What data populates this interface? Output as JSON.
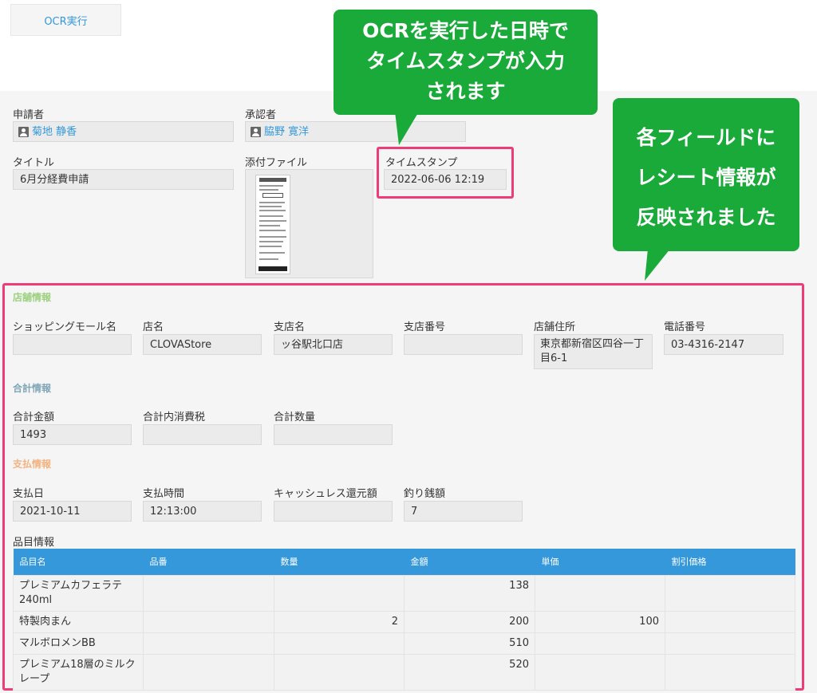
{
  "toolbar": {
    "ocr_button": "OCR実行"
  },
  "record": {
    "applicant": {
      "label": "申請者",
      "value": "菊地 静香"
    },
    "approver": {
      "label": "承認者",
      "value": "脇野 寛洋"
    },
    "title": {
      "label": "タイトル",
      "value": "6月分経費申請"
    },
    "attachment": {
      "label": "添付ファイル"
    },
    "timestamp": {
      "label": "タイムスタンプ",
      "value": "2022-06-06 12:19"
    }
  },
  "store_section": {
    "title": "店舗情報",
    "fields": [
      {
        "label": "ショッピングモール名",
        "value": ""
      },
      {
        "label": "店名",
        "value": "CLOVAStore"
      },
      {
        "label": "支店名",
        "value": "ッ谷駅北口店"
      },
      {
        "label": "支店番号",
        "value": ""
      },
      {
        "label": "店舗住所",
        "value": "東京都新宿区四谷一丁目6-1"
      },
      {
        "label": "電話番号",
        "value": "03-4316-2147"
      }
    ]
  },
  "total_section": {
    "title": "合計情報",
    "fields": [
      {
        "label": "合計金額",
        "value": "1493"
      },
      {
        "label": "合計内消費税",
        "value": ""
      },
      {
        "label": "合計数量",
        "value": ""
      }
    ]
  },
  "payment_section": {
    "title": "支払情報",
    "fields": [
      {
        "label": "支払日",
        "value": "2021-10-11"
      },
      {
        "label": "支払時間",
        "value": "12:13:00"
      },
      {
        "label": "キャッシュレス還元額",
        "value": ""
      },
      {
        "label": "釣り銭額",
        "value": "7"
      }
    ]
  },
  "items_section": {
    "title": "品目情報",
    "columns": [
      "品目名",
      "品番",
      "数量",
      "金額",
      "単価",
      "割引価格"
    ],
    "rows": [
      {
        "name": "プレミアムカフェラテ240ml",
        "code": "",
        "qty": "",
        "amount": "138",
        "unit": "",
        "discount": ""
      },
      {
        "name": "特製肉まん",
        "code": "",
        "qty": "2",
        "amount": "200",
        "unit": "100",
        "discount": ""
      },
      {
        "name": "マルボロメンBB",
        "code": "",
        "qty": "",
        "amount": "510",
        "unit": "",
        "discount": ""
      },
      {
        "name": "プレミアム18層のミルクレープ",
        "code": "",
        "qty": "",
        "amount": "520",
        "unit": "",
        "discount": ""
      }
    ]
  },
  "callouts": {
    "timestamp_note": [
      "OCRを実行した日時で",
      "タイムスタンプが入力",
      "されます"
    ],
    "fields_note": [
      "各フィールドに",
      "レシート情報が",
      "反映されました"
    ]
  },
  "colors": {
    "accent": "#3498db",
    "callout": "#1aaa3a",
    "highlight": "#ee3c78",
    "store_title": "#9bd17e",
    "total_title": "#7fa7b8",
    "payment_title": "#f3b27f"
  }
}
